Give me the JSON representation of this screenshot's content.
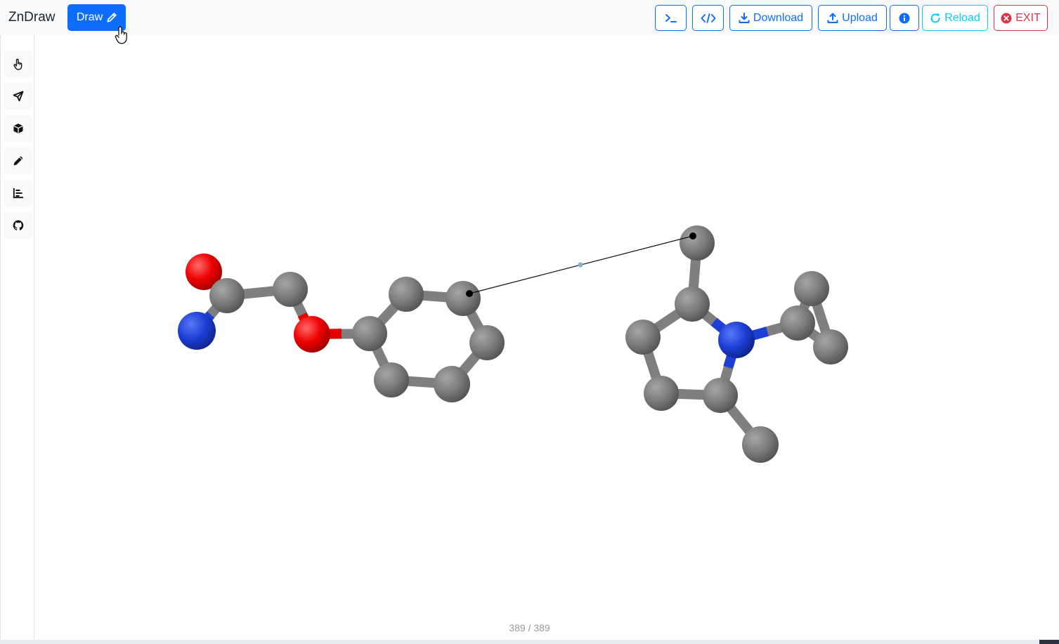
{
  "app": {
    "title": "ZnDraw"
  },
  "navbar": {
    "draw_label": "Draw",
    "download_label": "Download",
    "upload_label": "Upload",
    "reload_label": "Reload",
    "exit_label": "EXIT",
    "icons": {
      "draw": "pencil-icon",
      "terminal": "terminal-icon",
      "code": "code-icon",
      "download": "download-icon",
      "upload": "upload-icon",
      "info": "info-icon",
      "reload": "reload-icon",
      "exit": "close-circle-icon"
    }
  },
  "sidebar": {
    "items": [
      {
        "icon": "pointer-hand-icon"
      },
      {
        "icon": "send-plane-icon"
      },
      {
        "icon": "cube-icon"
      },
      {
        "icon": "pencil-icon"
      },
      {
        "icon": "bar-chart-icon"
      },
      {
        "icon": "github-icon"
      }
    ]
  },
  "viewer": {
    "frame_current": 389,
    "frame_total": 389,
    "frame_label": "389 / 389"
  },
  "colors": {
    "primary": "#0d6efd",
    "info": "#0dcaf0",
    "danger": "#dc3545",
    "carbon": "#7f7f7f",
    "nitrogen": "#1d3fd6",
    "oxygen": "#e60000"
  }
}
